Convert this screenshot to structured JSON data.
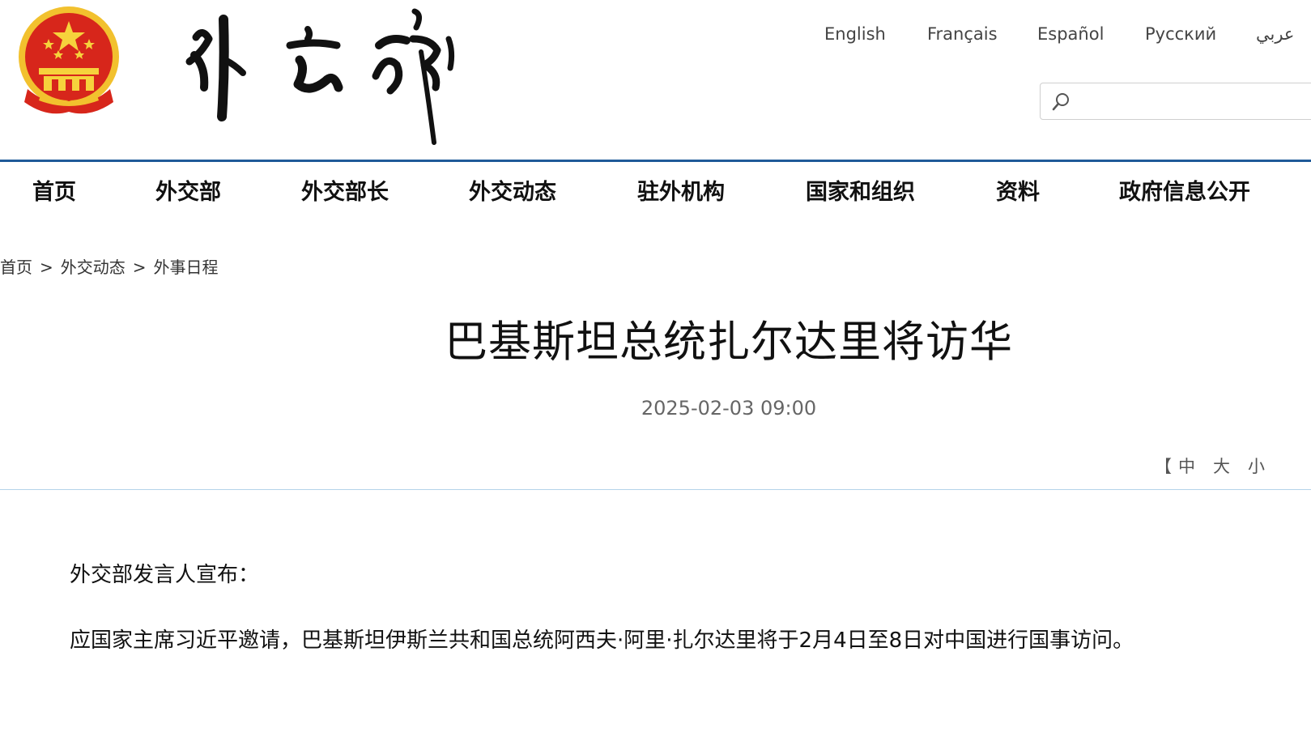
{
  "header": {
    "logo_text": "外交部",
    "languages": [
      "English",
      "Français",
      "Español",
      "Русский",
      "عربي"
    ],
    "search": {
      "placeholder": "",
      "value": ""
    }
  },
  "nav": {
    "items": [
      "首页",
      "外交部",
      "外交部长",
      "外交动态",
      "驻外机构",
      "国家和组织",
      "资料",
      "政府信息公开"
    ]
  },
  "breadcrumb": {
    "items": [
      "首页",
      "外交动态",
      "外事日程"
    ],
    "separator": ">"
  },
  "article": {
    "title": "巴基斯坦总统扎尔达里将访华",
    "date": "2025-02-03 09:00",
    "font_size_controls": {
      "open_bracket": "【",
      "medium": "中",
      "large": "大",
      "small": "小"
    },
    "paragraphs": [
      "外交部发言人宣布：",
      "应国家主席习近平邀请，巴基斯坦伊斯兰共和国总统阿西夫·阿里·扎尔达里将于2月4日至8日对中国进行国事访问。"
    ]
  },
  "colors": {
    "header_rule": "#1f5a99",
    "content_rule": "#b5d3ea",
    "emblem_red": "#d7261b",
    "emblem_gold": "#f2c12e"
  }
}
